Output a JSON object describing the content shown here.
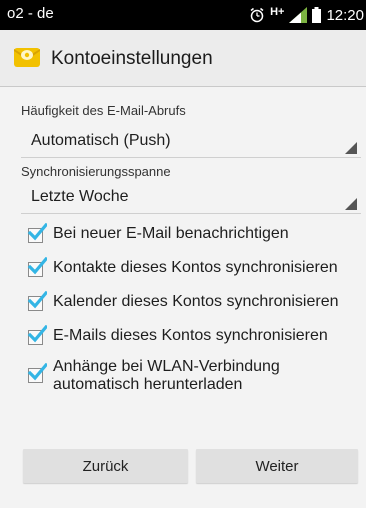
{
  "status_bar": {
    "carrier": "o2 - de",
    "network": "H+",
    "time": "12:20",
    "icons": [
      "alarm-icon",
      "signal-icon",
      "battery-icon"
    ]
  },
  "action_bar": {
    "title": "Kontoeinstellungen",
    "icon": "email-app-icon"
  },
  "settings": {
    "fetch_frequency": {
      "label": "Häufigkeit des E-Mail-Abrufs",
      "value": "Automatisch (Push)"
    },
    "sync_range": {
      "label": "Synchronisierungsspanne",
      "value": "Letzte Woche"
    },
    "checkboxes": [
      {
        "label": "Bei neuer E-Mail benachrichtigen",
        "checked": true
      },
      {
        "label": "Kontakte dieses Kontos synchronisieren",
        "checked": true
      },
      {
        "label": "Kalender dieses Kontos synchronisieren",
        "checked": true
      },
      {
        "label": "E-Mails dieses Kontos synchronisieren",
        "checked": true
      },
      {
        "label_line1": "Anhänge bei WLAN-Verbindung",
        "label_line2": "automatisch herunterladen",
        "checked": true
      }
    ]
  },
  "buttons": {
    "back": "Zurück",
    "next": "Weiter"
  },
  "colors": {
    "accent": "#33b5e5",
    "background": "#f3f3f3",
    "status_bar": "#000000"
  }
}
